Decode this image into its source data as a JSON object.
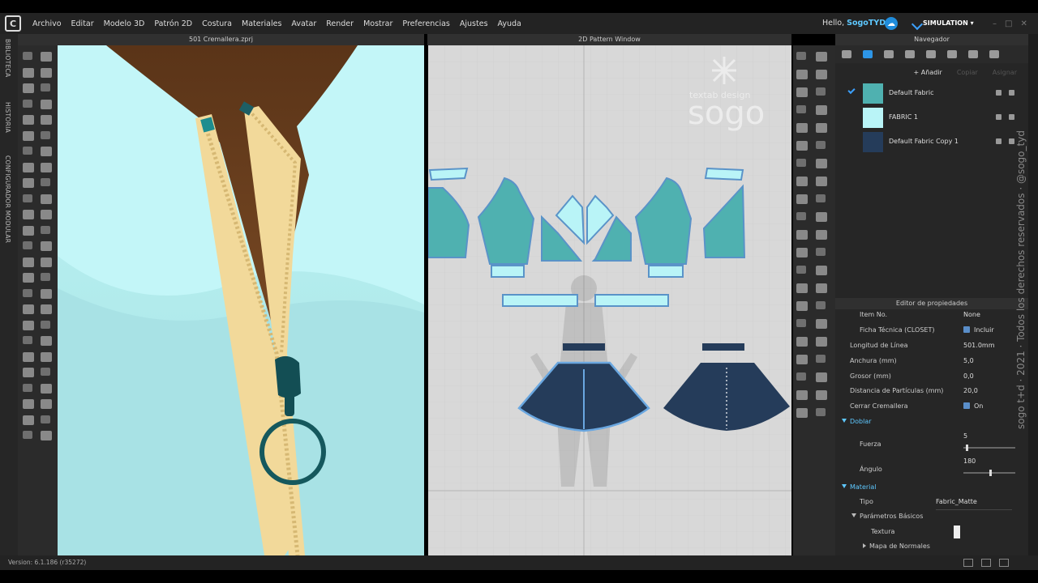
{
  "menu": [
    "Archivo",
    "Editar",
    "Modelo 3D",
    "Patrón 2D",
    "Costura",
    "Materiales",
    "Avatar",
    "Render",
    "Mostrar",
    "Preferencias",
    "Ajustes",
    "Ayuda"
  ],
  "user": {
    "greeting": "Hello,",
    "name": "SogoTYD"
  },
  "mode": "SIMULATION",
  "left_tabs": [
    "BIBLIOTECA",
    "HISTORIA",
    "CONFIGURADOR MODULAR"
  ],
  "view3d_title": "501 Cremallera.zprj",
  "view2d_title": "2D Pattern Window",
  "navigator": {
    "title": "Navegador",
    "add_label": "+ Añadir",
    "copy_label": "Copiar",
    "assign_label": "Asignar",
    "fabrics": [
      {
        "name": "Default Fabric",
        "color": "#4fb1b0",
        "selected": true
      },
      {
        "name": "FABRIC 1",
        "color": "#b9f4f7",
        "selected": false
      },
      {
        "name": "Default Fabric Copy 1",
        "color": "#253c5a",
        "selected": false
      }
    ]
  },
  "properties": {
    "title": "Editor de propiedades",
    "item_no": {
      "label": "Item No.",
      "value": "None"
    },
    "ficha": {
      "label": "Ficha Técnica (CLOSET)",
      "value": "Incluir"
    },
    "longitud": {
      "label": "Longitud de Línea",
      "value": "501.0mm"
    },
    "anchura": {
      "label": "Anchura (mm)",
      "value": "5,0"
    },
    "grosor": {
      "label": "Grosor (mm)",
      "value": "0,0"
    },
    "distancia": {
      "label": "Distancia de Partículas (mm)",
      "value": "20,0"
    },
    "cerrar": {
      "label": "Cerrar Cremallera",
      "value": "On"
    },
    "doblar": "Doblar",
    "fuerza": {
      "label": "Fuerza",
      "value": "5",
      "fraction": 0.05
    },
    "angulo": {
      "label": "Ángulo",
      "value": "180",
      "fraction": 0.5
    },
    "material": "Material",
    "tipo": {
      "label": "Tipo",
      "value": "Fabric_Matte"
    },
    "parametros": "Parámetros Básicos",
    "textura": "Textura",
    "mapa": "Mapa de Normales"
  },
  "brand": {
    "small": "textab design",
    "big": "sogo"
  },
  "watermark": "sogo t+d · 2021 · Todos los derechos reservados · @sogo_tyd",
  "version": "Version: 6.1.186 (r35272)",
  "colors": {
    "teal": "#4fb1b0",
    "light": "#b9f4f7",
    "navy": "#253c5a",
    "accent": "#5ec8ff",
    "zipper": "#f2d99a"
  }
}
